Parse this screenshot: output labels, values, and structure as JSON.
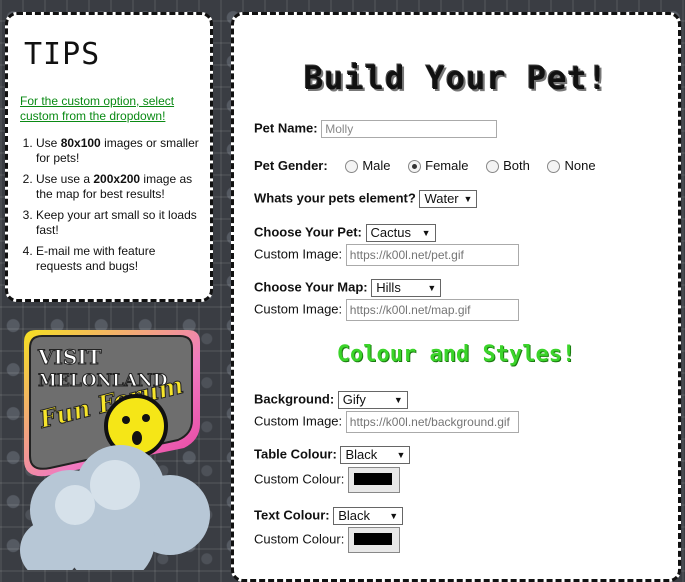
{
  "tips": {
    "title": "TIPS",
    "link": "For the custom option, select custom from the dropdown!",
    "items": [
      {
        "pre": "Use ",
        "bold": "80x100",
        "post": " images or smaller for pets!"
      },
      {
        "pre": "Use use a ",
        "bold": "200x200",
        "post": " image as the map for best results!"
      },
      {
        "pre": "Keep your art small so it loads fast!",
        "bold": "",
        "post": ""
      },
      {
        "pre": "E-mail me with feature requests and bugs!",
        "bold": "",
        "post": ""
      }
    ]
  },
  "badge": {
    "line1": "VISIT",
    "line2": "MELONLAND",
    "line3": "Fun Forum"
  },
  "form": {
    "title": "Build Your Pet!",
    "pet_name_label": "Pet Name:",
    "pet_name_value": "Molly",
    "gender_label": "Pet Gender:",
    "genders": [
      "Male",
      "Female",
      "Both",
      "None"
    ],
    "gender_selected": "Female",
    "element_label": "Whats your pets element?",
    "element_value": "Water",
    "choose_pet_label": "Choose Your Pet:",
    "choose_pet_value": "Cactus",
    "custom_image_label": "Custom Image:",
    "pet_image_placeholder": "https://k00l.net/pet.gif",
    "choose_map_label": "Choose Your Map:",
    "choose_map_value": "Hills",
    "map_image_placeholder": "https://k00l.net/map.gif",
    "styles_title": "Colour and Styles!",
    "background_label": "Background:",
    "background_value": "Gify",
    "background_image_placeholder": "https://k00l.net/background.gif",
    "table_colour_label": "Table Colour:",
    "table_colour_value": "Black",
    "custom_colour_label": "Custom Colour:",
    "text_colour_label": "Text Colour:",
    "text_colour_value": "Black",
    "swatch_color": "#000000"
  }
}
